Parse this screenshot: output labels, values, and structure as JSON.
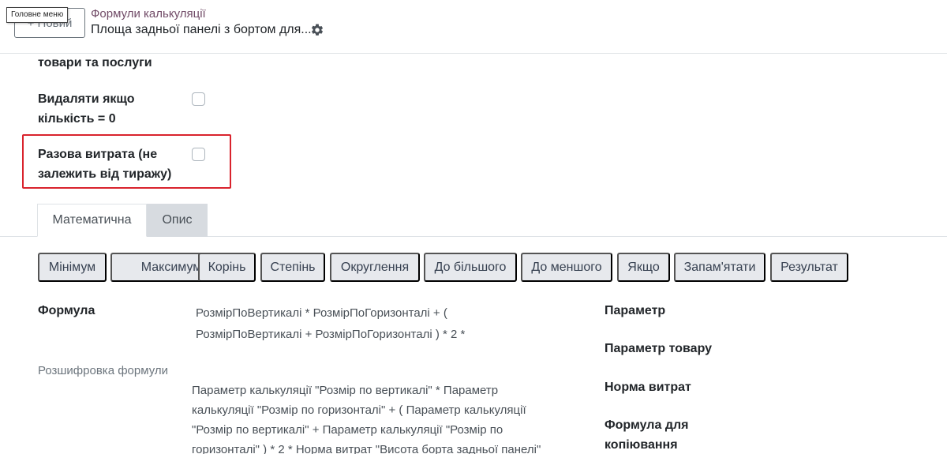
{
  "header": {
    "new_button": "+ Новий",
    "tooltip": "Головне меню",
    "breadcrumb_parent": "Формули калькуляції",
    "breadcrumb_current": "Площа задньої панелі з бортом для...",
    "gear_icon": "gear-icon"
  },
  "form": {
    "partial_label": "товари та послуги",
    "delete_if_zero_label_line1": "Видаляти якщо",
    "delete_if_zero_label_line2": "кількість = 0",
    "delete_if_zero_checked": false,
    "one_time_cost_label_line1": "Разова витрата (не",
    "one_time_cost_label_line2": "залежить від тиражу)",
    "one_time_cost_checked": false,
    "highlight_color": "#d9232d"
  },
  "tabs": [
    {
      "label": "Математична",
      "active": true
    },
    {
      "label": "Опис",
      "active": false
    }
  ],
  "operators": [
    "Мінімум",
    "Максимум",
    "Корінь",
    "Степінь",
    "Округлення",
    "До більшого",
    "До меншого",
    "Якщо",
    "Запам'ятати",
    "Результат"
  ],
  "formula": {
    "label": "Формула",
    "line1": "РозмірПоВертикалі * РозмірПоГоризонталі + (",
    "line2": "РозмірПоВертикалі + РозмірПоГоризонталі ) * 2 *"
  },
  "decoded": {
    "label": "Розшифровка формули",
    "line1": "Параметр калькуляції \"Розмір по вертикалі\" * Параметр",
    "line2": "калькуляції \"Розмір по горизонталі\" +  ( Параметр калькуляції",
    "line3": "\"Розмір по вертикалі\" + Параметр калькуляції \"Розмір по",
    "line4": "горизонталі\" )  *  2  * Норма витрат \"Висота борта задньої панелі\""
  },
  "side_fields": {
    "parameter": "Параметр",
    "product_parameter": "Параметр товару",
    "consumption_norm": "Норма витрат",
    "copy_formula_line1": "Формула для",
    "copy_formula_line2": "копіювання"
  }
}
